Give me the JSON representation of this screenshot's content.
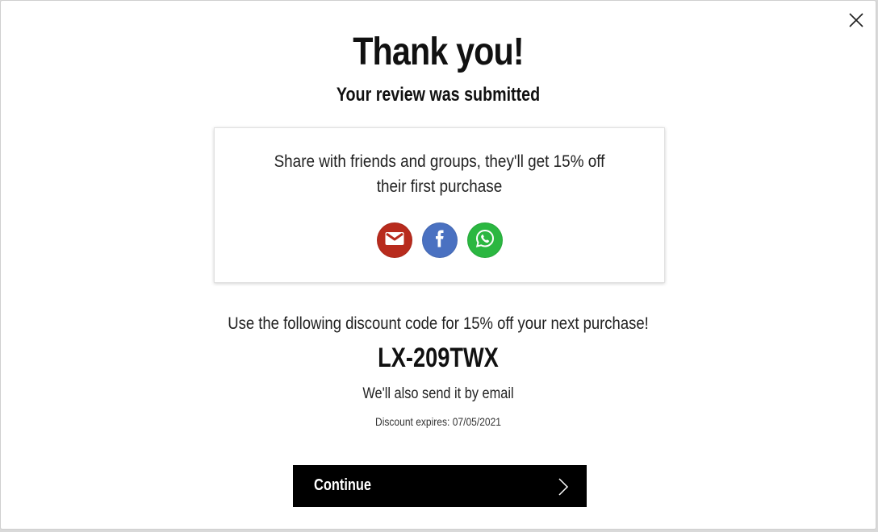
{
  "modal": {
    "title": "Thank you!",
    "subtitle": "Your review was submitted",
    "close_icon": "close-icon"
  },
  "share": {
    "text": "Share with friends and groups, they'll get 15% off their first purchase",
    "buttons": [
      {
        "name": "email",
        "icon": "email-icon",
        "color": "#b82b1d"
      },
      {
        "name": "facebook",
        "icon": "facebook-icon",
        "color": "#4a71c1"
      },
      {
        "name": "whatsapp",
        "icon": "whatsapp-icon",
        "color": "#2bb741"
      }
    ]
  },
  "discount": {
    "intro": "Use the following discount code for 15% off your next purchase!",
    "code": "LX-209TWX",
    "email_note": "We'll also send it by email",
    "expires": "Discount expires: 07/05/2021"
  },
  "continue": {
    "label": "Continue",
    "icon": "chevron-right-icon"
  }
}
